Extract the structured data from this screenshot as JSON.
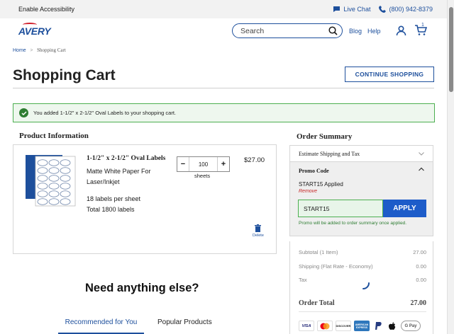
{
  "topbar": {
    "accessibility": "Enable Accessibility",
    "live_chat": "Live Chat",
    "phone": "(800) 942-8379"
  },
  "header": {
    "logo": "AVERY",
    "search_placeholder": "Search",
    "blog": "Blog",
    "help": "Help",
    "cart_count": "1"
  },
  "breadcrumb": {
    "home": "Home",
    "sep": ">",
    "current": "Shopping Cart"
  },
  "page": {
    "title": "Shopping Cart",
    "continue_label": "CONTINUE SHOPPING"
  },
  "alert": {
    "message": "You added 1-1/2\" x 2-1/2\" Oval Labels to your shopping cart."
  },
  "product_section": {
    "heading": "Product Information",
    "item": {
      "name": "1-1/2\" x 2-1/2\" Oval Labels",
      "desc_line1": "Matte White Paper For",
      "desc_line2": "Laser/Inkjet",
      "per_sheet": "18 labels per sheet",
      "total": "Total 1800 labels",
      "quantity": "100",
      "qty_unit": "sheets",
      "price": "$27.00",
      "delete_label": "Delete"
    }
  },
  "more": {
    "heading": "Need anything else?",
    "tabs": [
      "Recommended for You",
      "Popular Products"
    ]
  },
  "summary": {
    "heading": "Order Summary",
    "estimate": "Estimate Shipping and Tax",
    "promo_heading": "Promo Code",
    "applied": "START15 Applied",
    "remove": "Remove",
    "promo_value": "START15",
    "apply": "APPLY",
    "note": "Promo will be added to order summary once applied.",
    "rows": [
      {
        "label": "Subtotal (1 Item)",
        "value": "27.00"
      },
      {
        "label": "Shipping (Flat Rate - Economy)",
        "value": "0.00"
      },
      {
        "label": "Tax",
        "value": "0.00"
      }
    ],
    "total_label": "Order Total",
    "total_value": "27.00",
    "payments": [
      "VISA",
      "Mastercard",
      "DISCOVER",
      "AMERICAN EXPRESS",
      "PayPal",
      "Apple Pay",
      "G Pay"
    ]
  },
  "colors": {
    "brand_blue": "#1d4f9c",
    "success_green": "#2e7d32",
    "error_red": "#c62828"
  }
}
